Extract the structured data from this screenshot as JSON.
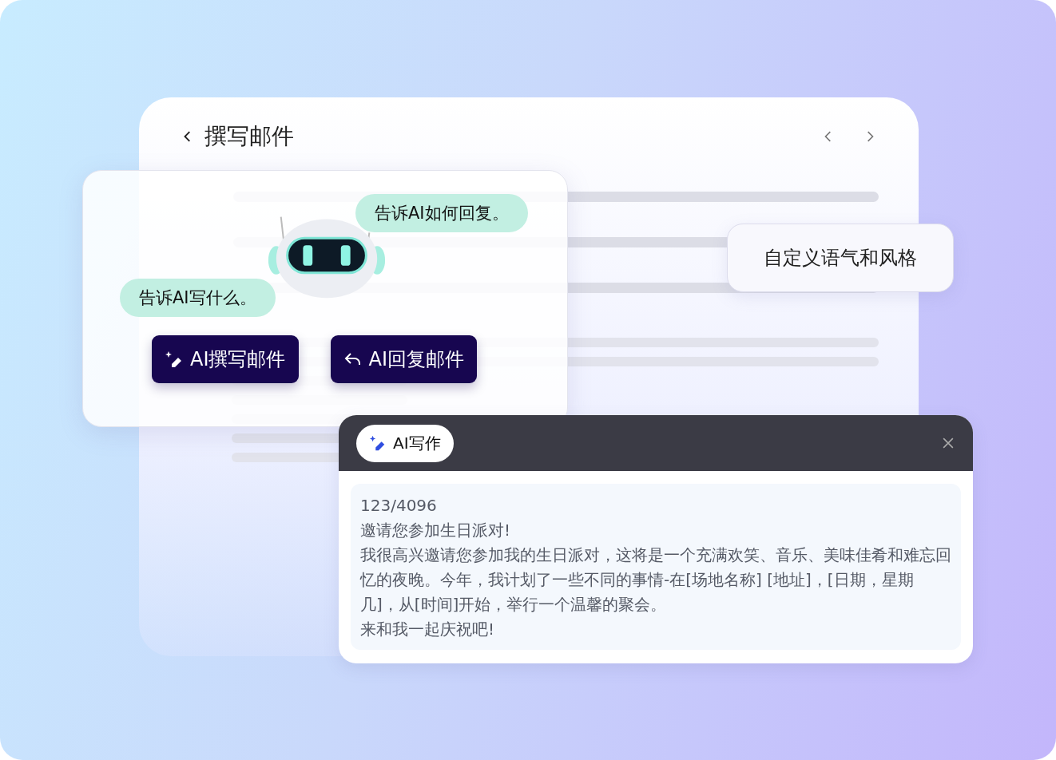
{
  "main_window": {
    "title": "撰写邮件"
  },
  "prompt_card": {
    "bubbles": [
      {
        "text": "告诉AI如何回复。",
        "kind": "right"
      },
      {
        "text": "告诉AI写什么。",
        "kind": "left"
      }
    ],
    "buttons": [
      {
        "label": "AI撰写邮件",
        "kind": "write"
      },
      {
        "label": "AI回复邮件",
        "kind": "reply"
      }
    ]
  },
  "style_tag": {
    "label": "自定义语气和风格"
  },
  "ai_panel": {
    "title": "AI写作",
    "counter": "123/4096",
    "lines": [
      "邀请您参加生日派对!",
      "我很高兴邀请您参加我的生日派对，这将是一个充满欢笑、音乐、美味佳肴和难忘回忆的夜晚。今年，我计划了一些不同的事情-在[场地名称] [地址]，[日期，星期几]，从[时间]开始，举行一个温馨的聚会。",
      "来和我一起庆祝吧!"
    ]
  }
}
